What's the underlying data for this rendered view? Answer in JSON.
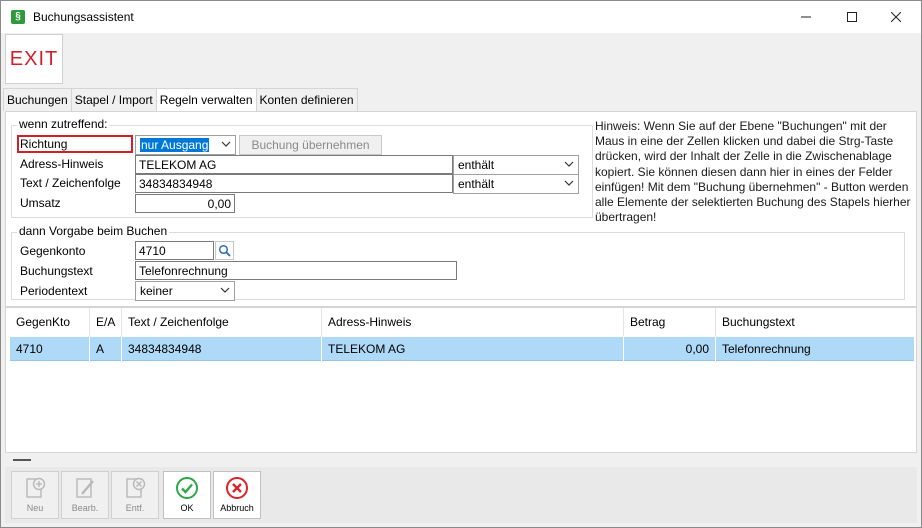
{
  "window": {
    "title": "Buchungsassistent"
  },
  "toolbar": {
    "exit_label": "EXIT"
  },
  "tabs": [
    {
      "label": "Buchungen",
      "active": false
    },
    {
      "label": "Stapel / Import",
      "active": false
    },
    {
      "label": "Regeln verwalten",
      "active": true
    },
    {
      "label": "Konten definieren",
      "active": false
    }
  ],
  "conditions": {
    "legend": "wenn zutreffend:",
    "richtung_label": "Richtung",
    "richtung_value": "nur Ausgang",
    "apply_button": "Buchung übernehmen",
    "adress_label": "Adress-Hinweis",
    "adress_value": "TELEKOM AG",
    "adress_match": "enthält",
    "text_label": "Text / Zeichenfolge",
    "text_value": "34834834948",
    "text_match": "enthält",
    "umsatz_label": "Umsatz",
    "umsatz_value": "0,00"
  },
  "defaults": {
    "legend": "dann Vorgabe beim Buchen",
    "gegenkonto_label": "Gegenkonto",
    "gegenkonto_value": "4710",
    "buchungstext_label": "Buchungstext",
    "buchungstext_value": "Telefonrechnung",
    "periodentext_label": "Periodentext",
    "periodentext_value": "keiner"
  },
  "hint": "Hinweis: Wenn Sie auf der Ebene \"Buchungen\" mit der Maus in eine der Zellen klicken und dabei die Strg-Taste drücken, wird der Inhalt der Zelle in die Zwischenablage kopiert. Sie können diesen dann hier in eines der Felder einfügen! Mit dem \"Buchung übernehmen\" - Button werden alle Elemente der selektierten Buchung des Stapels hierher übertragen!",
  "table": {
    "columns": [
      "GegenKto",
      "E/A",
      "Text / Zeichenfolge",
      "Adress-Hinweis",
      "Betrag",
      "Buchungstext"
    ],
    "rows": [
      [
        "4710",
        "A",
        "34834834948",
        "TELEKOM AG",
        "0,00",
        "Telefonrechnung"
      ]
    ]
  },
  "buttons": {
    "neu": "Neu",
    "bearb": "Bearb.",
    "entf": "Entf.",
    "ok": "OK",
    "abbruch": "Abbruch"
  },
  "colors": {
    "exit": "#d0202a",
    "selected_row": "#aed9f7",
    "ok_green": "#2aa84a",
    "cancel_red": "#d9232d",
    "highlight_border": "#d0202a",
    "select_highlight": "#0078d7"
  }
}
